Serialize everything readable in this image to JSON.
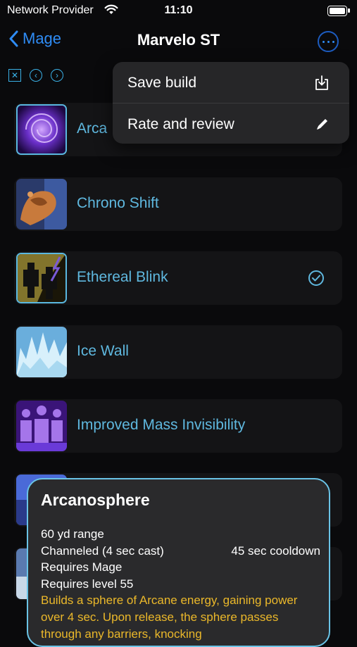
{
  "status_bar": {
    "carrier": "Network Provider",
    "time": "11:10"
  },
  "nav": {
    "back_label": "Mage",
    "title": "Marvelo ST"
  },
  "menu": {
    "items": [
      {
        "label": "Save build",
        "icon": "save-download-icon"
      },
      {
        "label": "Rate and review",
        "icon": "pencil-icon"
      }
    ]
  },
  "abilities": [
    {
      "label": "Arcanosphere",
      "visible_label": "Arca",
      "selected": true
    },
    {
      "label": "Chrono Shift",
      "selected": false
    },
    {
      "label": "Ethereal Blink",
      "selected": true,
      "checked": true
    },
    {
      "label": "Ice Wall",
      "selected": false
    },
    {
      "label": "Improved Mass Invisibility",
      "selected": false
    }
  ],
  "tooltip": {
    "title": "Arcanosphere",
    "range": "60 yd range",
    "cast": "Channeled (4 sec cast)",
    "cooldown": "45 sec cooldown",
    "req_class": "Requires Mage",
    "req_level": "Requires level 55",
    "description": "Builds a sphere of Arcane energy, gaining power over 4 sec. Upon release, the sphere passes through any barriers, knocking"
  },
  "colors": {
    "accent": "#2f8cf5",
    "ability_text": "#5fb8df",
    "description": "#ebb82a"
  }
}
